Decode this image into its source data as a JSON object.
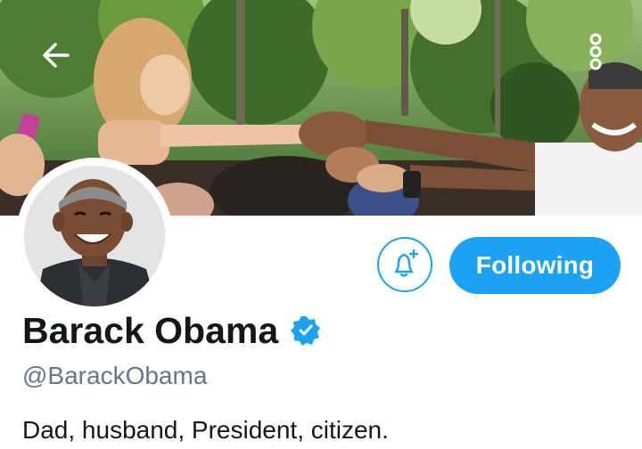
{
  "header": {
    "back_icon": "arrow-left-icon",
    "menu_icon": "vertical-dots-icon"
  },
  "profile": {
    "display_name": "Barack Obama",
    "verified_icon": "verified-badge-icon",
    "handle": "@BarackObama",
    "bio": "Dad, husband, President, citizen."
  },
  "actions": {
    "notify_icon": "bell-plus-icon",
    "following_label": "Following"
  },
  "colors": {
    "accent": "#1da1f2",
    "text_primary": "#14171a",
    "text_secondary": "#657786"
  }
}
